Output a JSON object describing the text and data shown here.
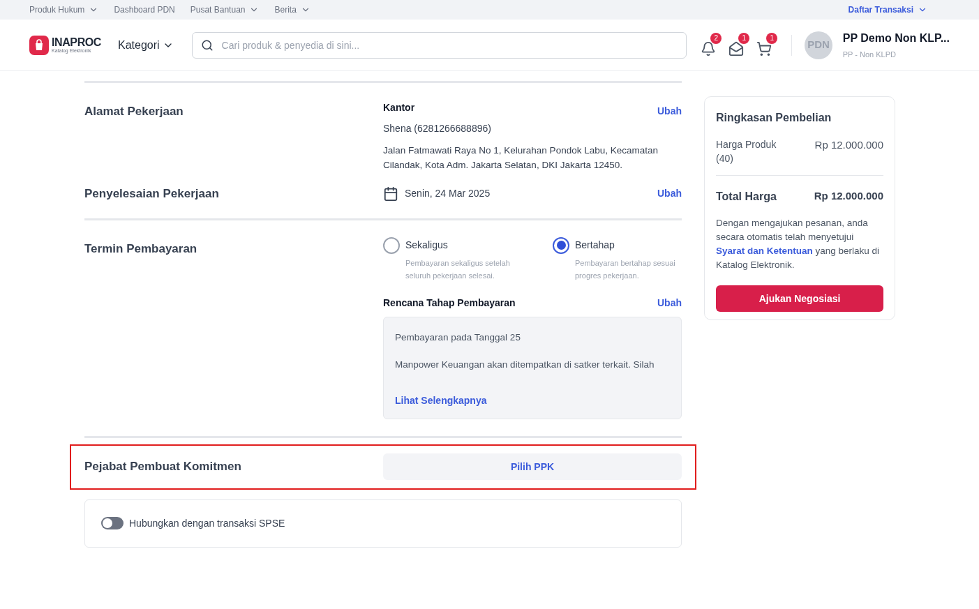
{
  "top_bar": {
    "links": [
      {
        "label": "Produk Hukum",
        "dropdown": true
      },
      {
        "label": "Dashboard PDN",
        "dropdown": false
      },
      {
        "label": "Pusat Bantuan",
        "dropdown": true
      },
      {
        "label": "Berita",
        "dropdown": true
      }
    ],
    "right_link": {
      "label": "Daftar Transaksi",
      "dropdown": true
    }
  },
  "header": {
    "logo": {
      "name": "INAPROC",
      "tagline": "Katalog Elektronik"
    },
    "category": "Kategori",
    "search": {
      "placeholder": "Cari produk & penyedia di sini..."
    },
    "icons": [
      {
        "kind": "bell",
        "badge": "2"
      },
      {
        "kind": "mail",
        "badge": "1"
      },
      {
        "kind": "cart",
        "badge": "1"
      }
    ],
    "user": {
      "avatar": "PDN",
      "name": "PP Demo Non KLP...",
      "role": "PP - Non KLPD"
    }
  },
  "address": {
    "title": "Alamat Pekerjaan",
    "label": "Kantor",
    "action": "Ubah",
    "contact": "Shena (6281266688896)",
    "address": "Jalan Fatmawati Raya No 1, Kelurahan Pondok Labu, Kecamatan Cilandak, Kota Adm. Jakarta Selatan, DKI Jakarta 12450."
  },
  "completion": {
    "title": "Penyelesaian Pekerjaan",
    "date": "Senin, 24 Mar 2025",
    "action": "Ubah"
  },
  "payment": {
    "title": "Termin Pembayaran",
    "options": [
      {
        "label": "Sekaligus",
        "description": "Pembayaran sekaligus setelah seluruh pekerjaan selesai.",
        "selected": false
      },
      {
        "label": "Bertahap",
        "description": "Pembayaran bertahap sesuai progres pekerjaan.",
        "selected": true
      }
    ],
    "plan": {
      "title": "Rencana Tahap Pembayaran",
      "action": "Ubah",
      "lines": [
        "Pembayaran pada Tanggal 25",
        "Manpower Keuangan akan ditempatkan di satker terkait. Silah"
      ],
      "link": "Lihat Selengkapnya"
    }
  },
  "ppk": {
    "title": "Pejabat Pembuat Komitmen",
    "button": "Pilih PPK",
    "highlighted": true
  },
  "spse_toggle": {
    "label": "Hubungkan dengan transaksi SPSE",
    "on": false
  },
  "summary": {
    "title": "Ringkasan Pembelian",
    "price_label": "Harga Produk (40)",
    "price": "Rp 12.000.000",
    "total_label": "Total Harga",
    "total": "Rp 12.000.000",
    "terms_before": "Dengan mengajukan pesanan, anda secara otomatis telah menyetujui",
    "terms_link": "Syarat dan Ketentuan",
    "terms_after": "yang berlaku di Katalog Elektronik.",
    "button": "Ajukan Negosiasi"
  }
}
